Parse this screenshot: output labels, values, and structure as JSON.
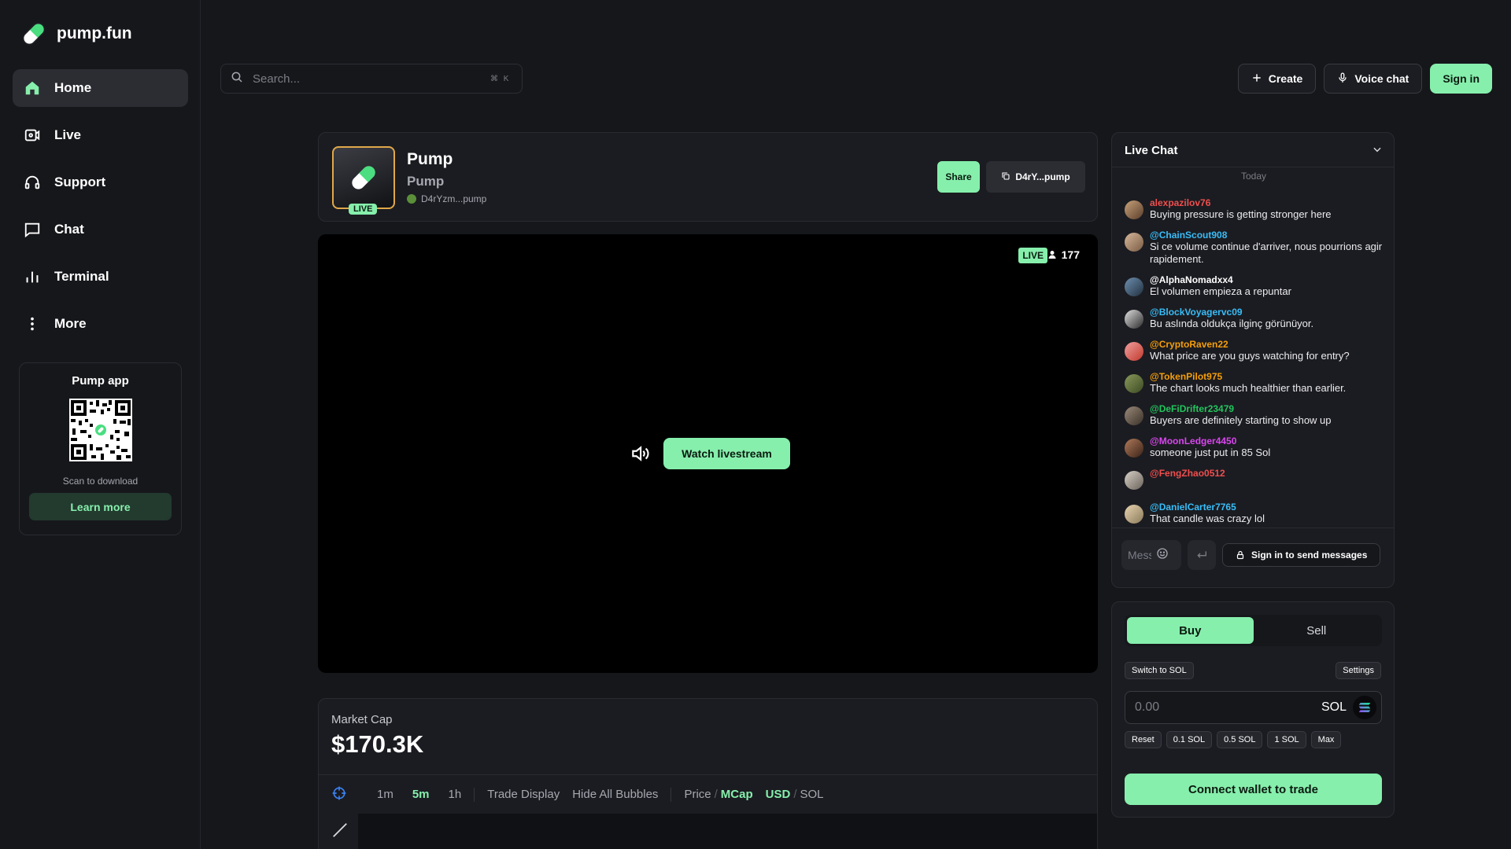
{
  "brand": {
    "name": "pump.fun",
    "accent": "#86efac"
  },
  "sidebar": {
    "items": [
      {
        "label": "Home",
        "icon": "home-icon"
      },
      {
        "label": "Live",
        "icon": "live-icon"
      },
      {
        "label": "Support",
        "icon": "headphones-icon"
      },
      {
        "label": "Chat",
        "icon": "chat-icon"
      },
      {
        "label": "Terminal",
        "icon": "bar-chart-icon"
      },
      {
        "label": "More",
        "icon": "more-icon"
      }
    ],
    "app_card": {
      "title": "Pump app",
      "scan_text": "Scan to download",
      "learn_more": "Learn more"
    }
  },
  "search": {
    "placeholder": "Search...",
    "shortcut": "⌘ K"
  },
  "header": {
    "create": "Create",
    "voice_chat": "Voice chat",
    "sign_in": "Sign in"
  },
  "token": {
    "name": "Pump",
    "ticker": "Pump",
    "address_short": "D4rYzm...pump",
    "live_badge": "LIVE",
    "share": "Share",
    "ca_button": "D4rY...pump"
  },
  "stream": {
    "live_label": "LIVE",
    "viewers": "177",
    "watch_button": "Watch livestream"
  },
  "market": {
    "label": "Market Cap",
    "value": "$170.3K",
    "toolbar": {
      "intervals": [
        "1m",
        "5m",
        "1h"
      ],
      "active_interval": "5m",
      "trade_display": "Trade Display",
      "hide_bubbles": "Hide All Bubbles",
      "price": "Price",
      "mcap": "MCap",
      "usd": "USD",
      "sol": "SOL"
    }
  },
  "chat": {
    "title": "Live Chat",
    "date_divider": "Today",
    "messages": [
      {
        "user": "alexpazilov76",
        "text": "Buying pressure is getting stronger here",
        "color": "#f04e4e"
      },
      {
        "user": "@ChainScout908",
        "text": "Si ce volume continue d'arriver, nous pourrions agir rapidement.",
        "color": "#38bdf8"
      },
      {
        "user": "@AlphaNomadxx4",
        "text": "El volumen empieza a repuntar",
        "color": "#ffffff"
      },
      {
        "user": "@BlockVoyagervc09",
        "text": "Bu aslında oldukça ilginç görünüyor.",
        "color": "#38bdf8"
      },
      {
        "user": "@CryptoRaven22",
        "text": "What price are you guys watching for entry?",
        "color": "#f59e0b"
      },
      {
        "user": "@TokenPilot975",
        "text": "The chart looks much healthier than earlier.",
        "color": "#f59e0b"
      },
      {
        "user": "@DeFiDrifter23479",
        "text": "Buyers are definitely starting to show up",
        "color": "#22c55e"
      },
      {
        "user": "@MoonLedger4450",
        "text": "someone just put in 85 Sol",
        "color": "#d946ef"
      },
      {
        "user": "@FengZhao0512",
        "text": "",
        "color": "#f04e4e"
      },
      {
        "user": "@DanielCarter7765",
        "text": "That candle was crazy lol",
        "color": "#38bdf8"
      }
    ],
    "input_placeholder": "Message",
    "sign_in_to_send": "Sign in to send messages"
  },
  "trade": {
    "tabs": {
      "buy": "Buy",
      "sell": "Sell"
    },
    "switch": "Switch to SOL",
    "settings": "Settings",
    "amount_placeholder": "0.00",
    "currency": "SOL",
    "presets": [
      "Reset",
      "0.1 SOL",
      "0.5 SOL",
      "1 SOL",
      "Max"
    ],
    "connect": "Connect wallet to trade"
  }
}
